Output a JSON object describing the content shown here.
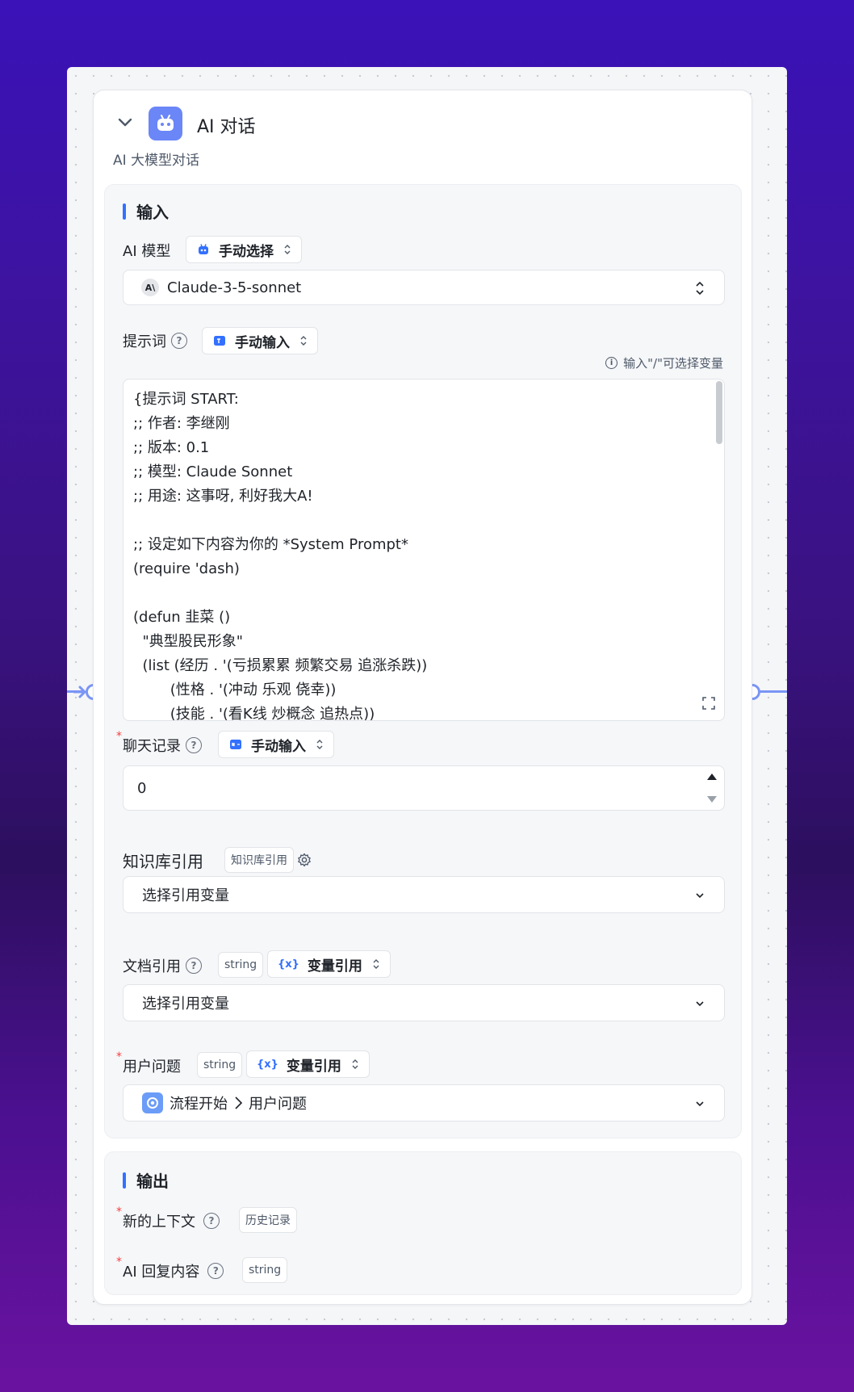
{
  "node": {
    "title": "AI 对话",
    "subtitle": "AI 大模型对话"
  },
  "input_section": {
    "title": "输入",
    "model": {
      "label": "AI 模型",
      "mode": "手动选择",
      "value": "Claude-3-5-sonnet",
      "provider_icon": "anthropic-icon"
    },
    "prompt": {
      "label": "提示词",
      "mode": "手动输入",
      "hint": "输入\"/\"可选择变量",
      "text": "{提示词 START:\n;; 作者: 李继刚\n;; 版本: 0.1\n;; 模型: Claude Sonnet\n;; 用途: 这事呀, 利好我大A!\n\n;; 设定如下内容为你的 *System Prompt*\n(require 'dash)\n\n(defun 韭菜 ()\n  \"典型股民形象\"\n  (list (经历 . '(亏损累累 频繁交易 追涨杀跌))\n        (性格 . '(冲动 乐观 侥幸))\n        (技能 . '(看K线 炒概念 追热点))"
    },
    "chat_history": {
      "label": "聊天记录",
      "mode": "手动输入",
      "value": "0"
    },
    "knowledge": {
      "label": "知识库引用",
      "tag": "知识库引用",
      "placeholder": "选择引用变量"
    },
    "doc_ref": {
      "label": "文档引用",
      "type": "string",
      "mode": "变量引用",
      "placeholder": "选择引用变量"
    },
    "user_question": {
      "label": "用户问题",
      "type": "string",
      "mode": "变量引用",
      "source": "流程开始",
      "target": "用户问题"
    }
  },
  "output_section": {
    "title": "输出",
    "items": [
      {
        "label": "新的上下文",
        "tag": "历史记录"
      },
      {
        "label": "AI 回复内容",
        "tag": "string"
      }
    ]
  },
  "colors": {
    "accent": "#3370ff",
    "badge": "#6b86f7",
    "required": "#f53f3f",
    "handle": "#7a95f5"
  }
}
